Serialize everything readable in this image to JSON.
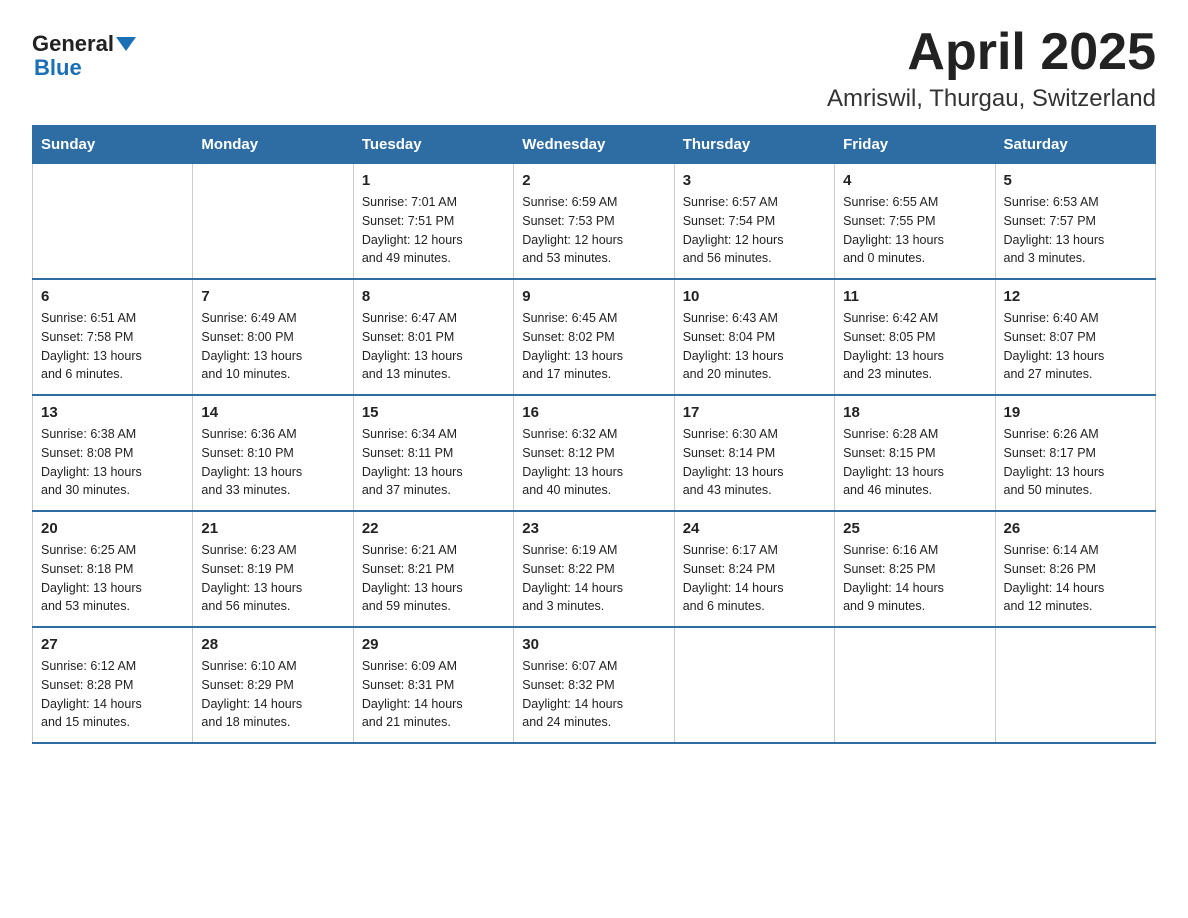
{
  "logo": {
    "word1": "General",
    "word2": "Blue"
  },
  "title": "April 2025",
  "subtitle": "Amriswil, Thurgau, Switzerland",
  "headers": [
    "Sunday",
    "Monday",
    "Tuesday",
    "Wednesday",
    "Thursday",
    "Friday",
    "Saturday"
  ],
  "weeks": [
    [
      {
        "day": "",
        "info": ""
      },
      {
        "day": "",
        "info": ""
      },
      {
        "day": "1",
        "info": "Sunrise: 7:01 AM\nSunset: 7:51 PM\nDaylight: 12 hours\nand 49 minutes."
      },
      {
        "day": "2",
        "info": "Sunrise: 6:59 AM\nSunset: 7:53 PM\nDaylight: 12 hours\nand 53 minutes."
      },
      {
        "day": "3",
        "info": "Sunrise: 6:57 AM\nSunset: 7:54 PM\nDaylight: 12 hours\nand 56 minutes."
      },
      {
        "day": "4",
        "info": "Sunrise: 6:55 AM\nSunset: 7:55 PM\nDaylight: 13 hours\nand 0 minutes."
      },
      {
        "day": "5",
        "info": "Sunrise: 6:53 AM\nSunset: 7:57 PM\nDaylight: 13 hours\nand 3 minutes."
      }
    ],
    [
      {
        "day": "6",
        "info": "Sunrise: 6:51 AM\nSunset: 7:58 PM\nDaylight: 13 hours\nand 6 minutes."
      },
      {
        "day": "7",
        "info": "Sunrise: 6:49 AM\nSunset: 8:00 PM\nDaylight: 13 hours\nand 10 minutes."
      },
      {
        "day": "8",
        "info": "Sunrise: 6:47 AM\nSunset: 8:01 PM\nDaylight: 13 hours\nand 13 minutes."
      },
      {
        "day": "9",
        "info": "Sunrise: 6:45 AM\nSunset: 8:02 PM\nDaylight: 13 hours\nand 17 minutes."
      },
      {
        "day": "10",
        "info": "Sunrise: 6:43 AM\nSunset: 8:04 PM\nDaylight: 13 hours\nand 20 minutes."
      },
      {
        "day": "11",
        "info": "Sunrise: 6:42 AM\nSunset: 8:05 PM\nDaylight: 13 hours\nand 23 minutes."
      },
      {
        "day": "12",
        "info": "Sunrise: 6:40 AM\nSunset: 8:07 PM\nDaylight: 13 hours\nand 27 minutes."
      }
    ],
    [
      {
        "day": "13",
        "info": "Sunrise: 6:38 AM\nSunset: 8:08 PM\nDaylight: 13 hours\nand 30 minutes."
      },
      {
        "day": "14",
        "info": "Sunrise: 6:36 AM\nSunset: 8:10 PM\nDaylight: 13 hours\nand 33 minutes."
      },
      {
        "day": "15",
        "info": "Sunrise: 6:34 AM\nSunset: 8:11 PM\nDaylight: 13 hours\nand 37 minutes."
      },
      {
        "day": "16",
        "info": "Sunrise: 6:32 AM\nSunset: 8:12 PM\nDaylight: 13 hours\nand 40 minutes."
      },
      {
        "day": "17",
        "info": "Sunrise: 6:30 AM\nSunset: 8:14 PM\nDaylight: 13 hours\nand 43 minutes."
      },
      {
        "day": "18",
        "info": "Sunrise: 6:28 AM\nSunset: 8:15 PM\nDaylight: 13 hours\nand 46 minutes."
      },
      {
        "day": "19",
        "info": "Sunrise: 6:26 AM\nSunset: 8:17 PM\nDaylight: 13 hours\nand 50 minutes."
      }
    ],
    [
      {
        "day": "20",
        "info": "Sunrise: 6:25 AM\nSunset: 8:18 PM\nDaylight: 13 hours\nand 53 minutes."
      },
      {
        "day": "21",
        "info": "Sunrise: 6:23 AM\nSunset: 8:19 PM\nDaylight: 13 hours\nand 56 minutes."
      },
      {
        "day": "22",
        "info": "Sunrise: 6:21 AM\nSunset: 8:21 PM\nDaylight: 13 hours\nand 59 minutes."
      },
      {
        "day": "23",
        "info": "Sunrise: 6:19 AM\nSunset: 8:22 PM\nDaylight: 14 hours\nand 3 minutes."
      },
      {
        "day": "24",
        "info": "Sunrise: 6:17 AM\nSunset: 8:24 PM\nDaylight: 14 hours\nand 6 minutes."
      },
      {
        "day": "25",
        "info": "Sunrise: 6:16 AM\nSunset: 8:25 PM\nDaylight: 14 hours\nand 9 minutes."
      },
      {
        "day": "26",
        "info": "Sunrise: 6:14 AM\nSunset: 8:26 PM\nDaylight: 14 hours\nand 12 minutes."
      }
    ],
    [
      {
        "day": "27",
        "info": "Sunrise: 6:12 AM\nSunset: 8:28 PM\nDaylight: 14 hours\nand 15 minutes."
      },
      {
        "day": "28",
        "info": "Sunrise: 6:10 AM\nSunset: 8:29 PM\nDaylight: 14 hours\nand 18 minutes."
      },
      {
        "day": "29",
        "info": "Sunrise: 6:09 AM\nSunset: 8:31 PM\nDaylight: 14 hours\nand 21 minutes."
      },
      {
        "day": "30",
        "info": "Sunrise: 6:07 AM\nSunset: 8:32 PM\nDaylight: 14 hours\nand 24 minutes."
      },
      {
        "day": "",
        "info": ""
      },
      {
        "day": "",
        "info": ""
      },
      {
        "day": "",
        "info": ""
      }
    ]
  ]
}
